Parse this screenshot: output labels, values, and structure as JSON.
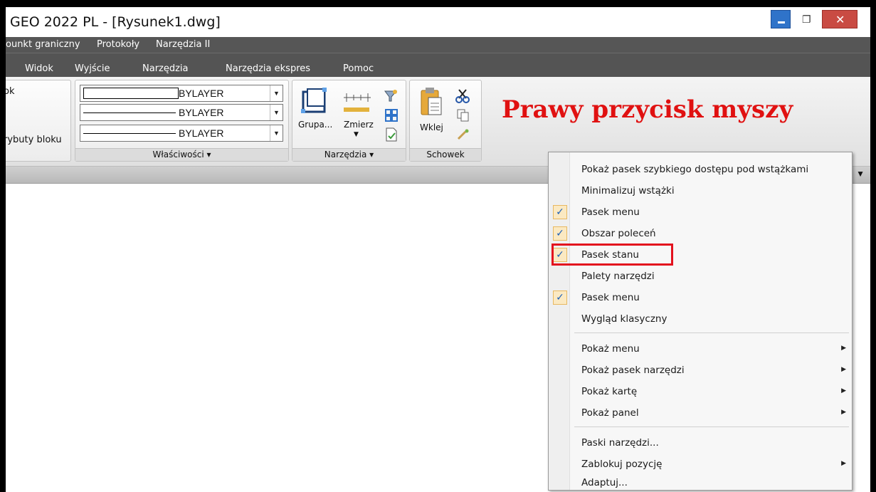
{
  "app": {
    "title": "GEO 2022 PL - [Rysunek1.dwg]"
  },
  "window_controls": {
    "minimize_icon": "minimize-icon",
    "restore_icon": "restore-icon",
    "close_icon": "close-icon",
    "close_glyph": "✕",
    "restore_glyph": "❐"
  },
  "menubar1": [
    "ounkt graniczny",
    "Protokoły",
    "Narzędzia II"
  ],
  "menubar2": [
    "Widok",
    "Wyjście",
    "Narzędzia",
    "Narzędzia ekspres",
    "Pomoc"
  ],
  "ribbon": {
    "left_panel": {
      "top_text": "ok",
      "bottom_text": "rybuty bloku"
    },
    "wlasciwosci": {
      "footer": "Właściwości ▾",
      "combos": [
        "BYLAYER",
        "BYLAYER",
        "BYLAYER"
      ]
    },
    "narzedzia": {
      "grupa_label": "Grupa...",
      "zmierz_label": "Zmierz",
      "footer": "Narzędzia ▾"
    },
    "schowek": {
      "wklej_label": "Wklej",
      "footer": "Schowek"
    }
  },
  "annotation": {
    "text": "Prawy przycisk myszy",
    "color": "#e01111"
  },
  "context_menu": {
    "items": [
      {
        "label": "Pokaż pasek szybkiego dostępu pod wstążkami",
        "checked": false
      },
      {
        "label": "Minimalizuj wstążki",
        "checked": false
      },
      {
        "label": "Pasek menu",
        "checked": true
      },
      {
        "label": "Obszar poleceń",
        "checked": true
      },
      {
        "label": "Pasek stanu",
        "checked": true,
        "highlighted": true
      },
      {
        "label": "Palety narzędzi",
        "checked": false
      },
      {
        "label": "Pasek menu",
        "checked": true
      },
      {
        "label": "Wygląd klasyczny",
        "checked": false
      },
      {
        "label": "Pokaż menu",
        "submenu": true
      },
      {
        "label": "Pokaż pasek narzędzi",
        "submenu": true
      },
      {
        "label": "Pokaż kartę",
        "submenu": true
      },
      {
        "label": "Pokaż panel",
        "submenu": true
      },
      {
        "label": "Paski narzędzi...",
        "submenu": false
      },
      {
        "label": "Zablokuj pozycję",
        "submenu": true
      },
      {
        "label": "Adaptuj...",
        "submenu": false
      }
    ],
    "check_glyph": "✓",
    "submenu_glyph": "▶"
  },
  "colors": {
    "accent": "#2f73c9",
    "close": "#c94b43",
    "highlight": "#e3121e",
    "menubar": "#565656"
  }
}
